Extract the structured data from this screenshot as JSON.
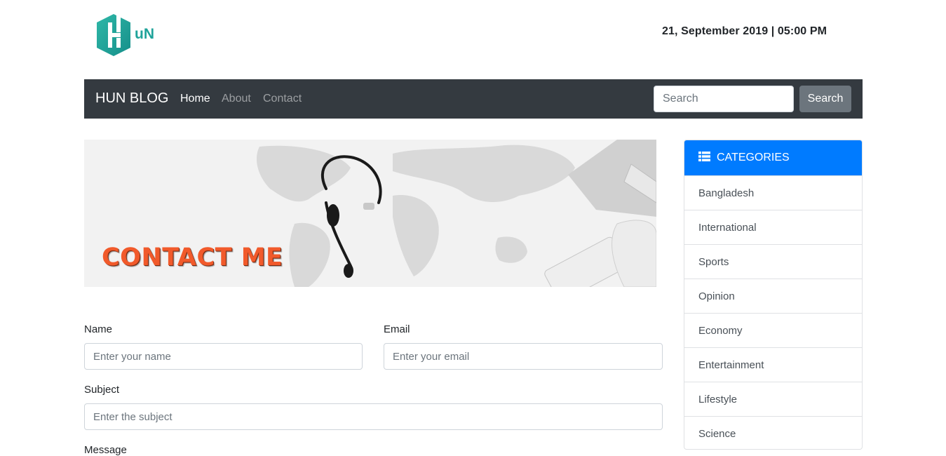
{
  "header": {
    "logo_text": "uN",
    "datetime": "21, September 2019 | 05:00 PM"
  },
  "navbar": {
    "brand": "HUN BLOG",
    "links": [
      "Home",
      "About",
      "Contact"
    ],
    "active_link": "Home",
    "search_placeholder": "Search",
    "search_button": "Search"
  },
  "banner": {
    "title": "CONTACT ME"
  },
  "form": {
    "name_label": "Name",
    "name_placeholder": "Enter your name",
    "email_label": "Email",
    "email_placeholder": "Enter your email",
    "subject_label": "Subject",
    "subject_placeholder": "Enter the subject",
    "message_label": "Message"
  },
  "sidebar": {
    "title": "CATEGORIES",
    "icon": "list-icon",
    "items": [
      "Bangladesh",
      "International",
      "Sports",
      "Opinion",
      "Economy",
      "Entertainment",
      "Lifestyle",
      "Science"
    ]
  },
  "colors": {
    "navbar_bg": "#343a40",
    "accent": "#007bff",
    "banner_title": "#f15a2b",
    "logo": "#1fa39a"
  }
}
